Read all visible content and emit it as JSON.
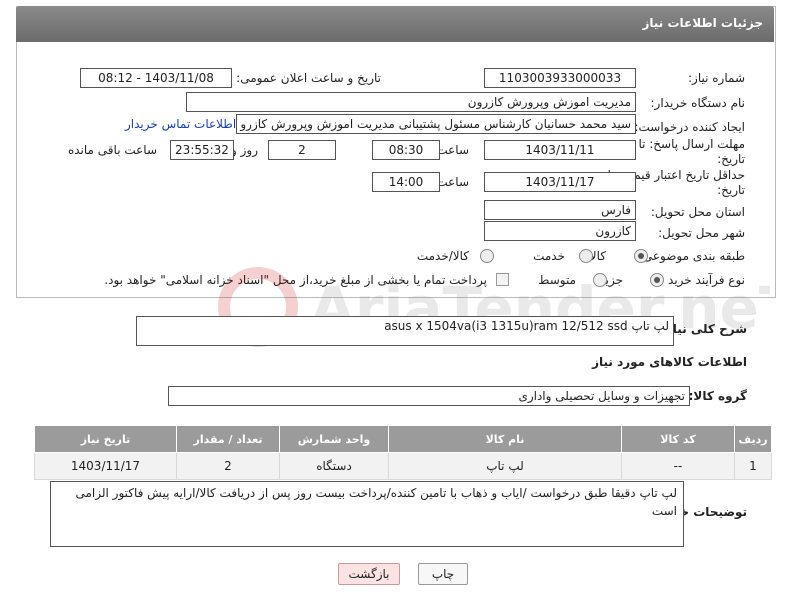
{
  "header": {
    "title": "جزئیات اطلاعات نیاز"
  },
  "form": {
    "need_number_label": "شماره نیاز:",
    "need_number": "1103003933000033",
    "announce_label": "تاریخ و ساعت اعلان عمومی:",
    "announce_value": "1403/11/08 - 08:12",
    "buyer_label": "نام دستگاه خریدار:",
    "buyer_value": "مدیریت اموزش وپرورش کازرون",
    "creator_label": "ایجاد کننده درخواست:",
    "creator_value": "سید محمد  حسانیان  کارشناس مسئول پشتیبانی مدیریت اموزش وپرورش کازرو",
    "contact_link": "اطلاعات تماس خریدار",
    "deadline_label_line1": "مهلت ارسال پاسخ: تا",
    "deadline_label_line2": "تاریخ:",
    "deadline_date": "1403/11/11",
    "time_label": "ساعت",
    "deadline_time": "08:30",
    "days_value": "2",
    "days_label": "روز و",
    "remaining_time": "23:55:32",
    "remaining_label": "ساعت باقی مانده",
    "validity_label_line1": "حداقل تاریخ اعتبار قیمت: تا",
    "validity_label_line2": "تاریخ:",
    "validity_date": "1403/11/17",
    "validity_time_label": "ساعت",
    "validity_time": "14:00",
    "province_label": "استان محل تحویل:",
    "province_value": "فارس",
    "city_label": "شهر محل تحویل:",
    "city_value": "کازرون",
    "category_label": "طبقه بندی موضوعی:",
    "category_options": [
      "کالا",
      "خدمت",
      "کالا/خدمت"
    ],
    "category_selected": "کالا",
    "process_label": "نوع فرآیند خرید :",
    "process_options": [
      "جزیی",
      "متوسط"
    ],
    "process_selected": "جزیی",
    "payment_text": "پرداخت تمام یا بخشی از مبلغ خرید،از محل \"اسناد خزانه اسلامی\" خواهد بود."
  },
  "description": {
    "label": "شرح کلی نیاز:",
    "value": "لپ تاپ  asus x 1504va(i3 1315u)ram 12/512 ssd"
  },
  "goods_section": {
    "title": "اطلاعات کالاهای مورد نیاز"
  },
  "goods_group": {
    "label": "گروه کالا:",
    "value": "تجهیزات و وسایل تحصیلی واداری"
  },
  "table": {
    "headers": [
      "ردیف",
      "کد کالا",
      "نام کالا",
      "واحد شمارش",
      "تعداد / مقدار",
      "تاریخ نیاز"
    ],
    "rows": [
      {
        "row": "1",
        "code": "--",
        "name": "لپ تاپ",
        "unit": "دستگاه",
        "qty": "2",
        "date": "1403/11/17"
      }
    ]
  },
  "buyer_notes": {
    "label": "توضیحات خریدار:",
    "value": "لپ تاپ دقیقا طبق درخواست /ایاب و ذهاب با تامین کننده/پرداخت بیست روز پس از دریافت کالا/ارایه پیش فاکتور الزامی است"
  },
  "buttons": {
    "print": "چاپ",
    "back": "بازگشت"
  },
  "watermark": {
    "text": "AriaTender.neT"
  }
}
